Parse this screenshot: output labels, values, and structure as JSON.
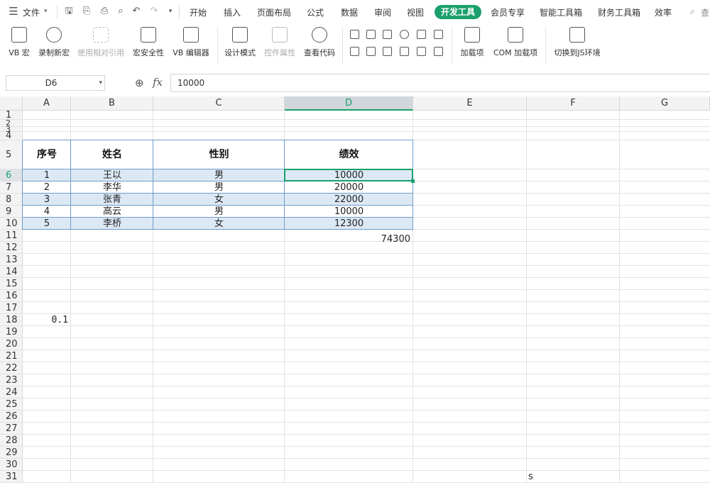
{
  "menubar": {
    "file_label": "文件",
    "tabs": [
      "开始",
      "插入",
      "页面布局",
      "公式",
      "数据",
      "审阅",
      "视图",
      "开发工具",
      "会员专享",
      "智能工具箱",
      "财务工具箱",
      "效率"
    ],
    "active_tab": "开发工具",
    "search_label": "查"
  },
  "ribbon": {
    "vb_macro": "VB 宏",
    "record_macro": "录制新宏",
    "relative_ref": "使用相对引用",
    "macro_security": "宏安全性",
    "vb_editor": "VB 编辑器",
    "design_mode": "设计模式",
    "control_props": "控件属性",
    "view_code": "查看代码",
    "addins": "加载项",
    "com_addins": "COM 加载项",
    "switch_js": "切换到JS环境"
  },
  "formula_bar": {
    "name_box": "D6",
    "formula": "10000",
    "fx": "fx"
  },
  "sheet": {
    "columns": [
      "A",
      "B",
      "C",
      "D",
      "E",
      "F",
      "G"
    ],
    "selected_column": "D",
    "row_numbers": [
      "1",
      "2",
      "3",
      "4",
      "5",
      "6",
      "7",
      "8",
      "9",
      "10",
      "11",
      "12",
      "13",
      "14",
      "15",
      "16",
      "17",
      "18",
      "19",
      "20",
      "21",
      "22",
      "23",
      "24",
      "25",
      "26",
      "27",
      "28",
      "29",
      "30",
      "31"
    ],
    "selected_row": "6",
    "table_headers": [
      "序号",
      "姓名",
      "性别",
      "绩效"
    ],
    "rows": [
      [
        "1",
        "王以",
        "男",
        "10000"
      ],
      [
        "2",
        "李华",
        "男",
        "20000"
      ],
      [
        "3",
        "张青",
        "女",
        "22000"
      ],
      [
        "4",
        "高云",
        "男",
        "10000"
      ],
      [
        "5",
        "李桥",
        "女",
        "12300"
      ]
    ],
    "total": "74300",
    "a18": "0.1",
    "f31": "s"
  },
  "colors": {
    "accent": "#1aa06c",
    "band": "#dce9f5",
    "table_border": "#6f9ccc"
  }
}
